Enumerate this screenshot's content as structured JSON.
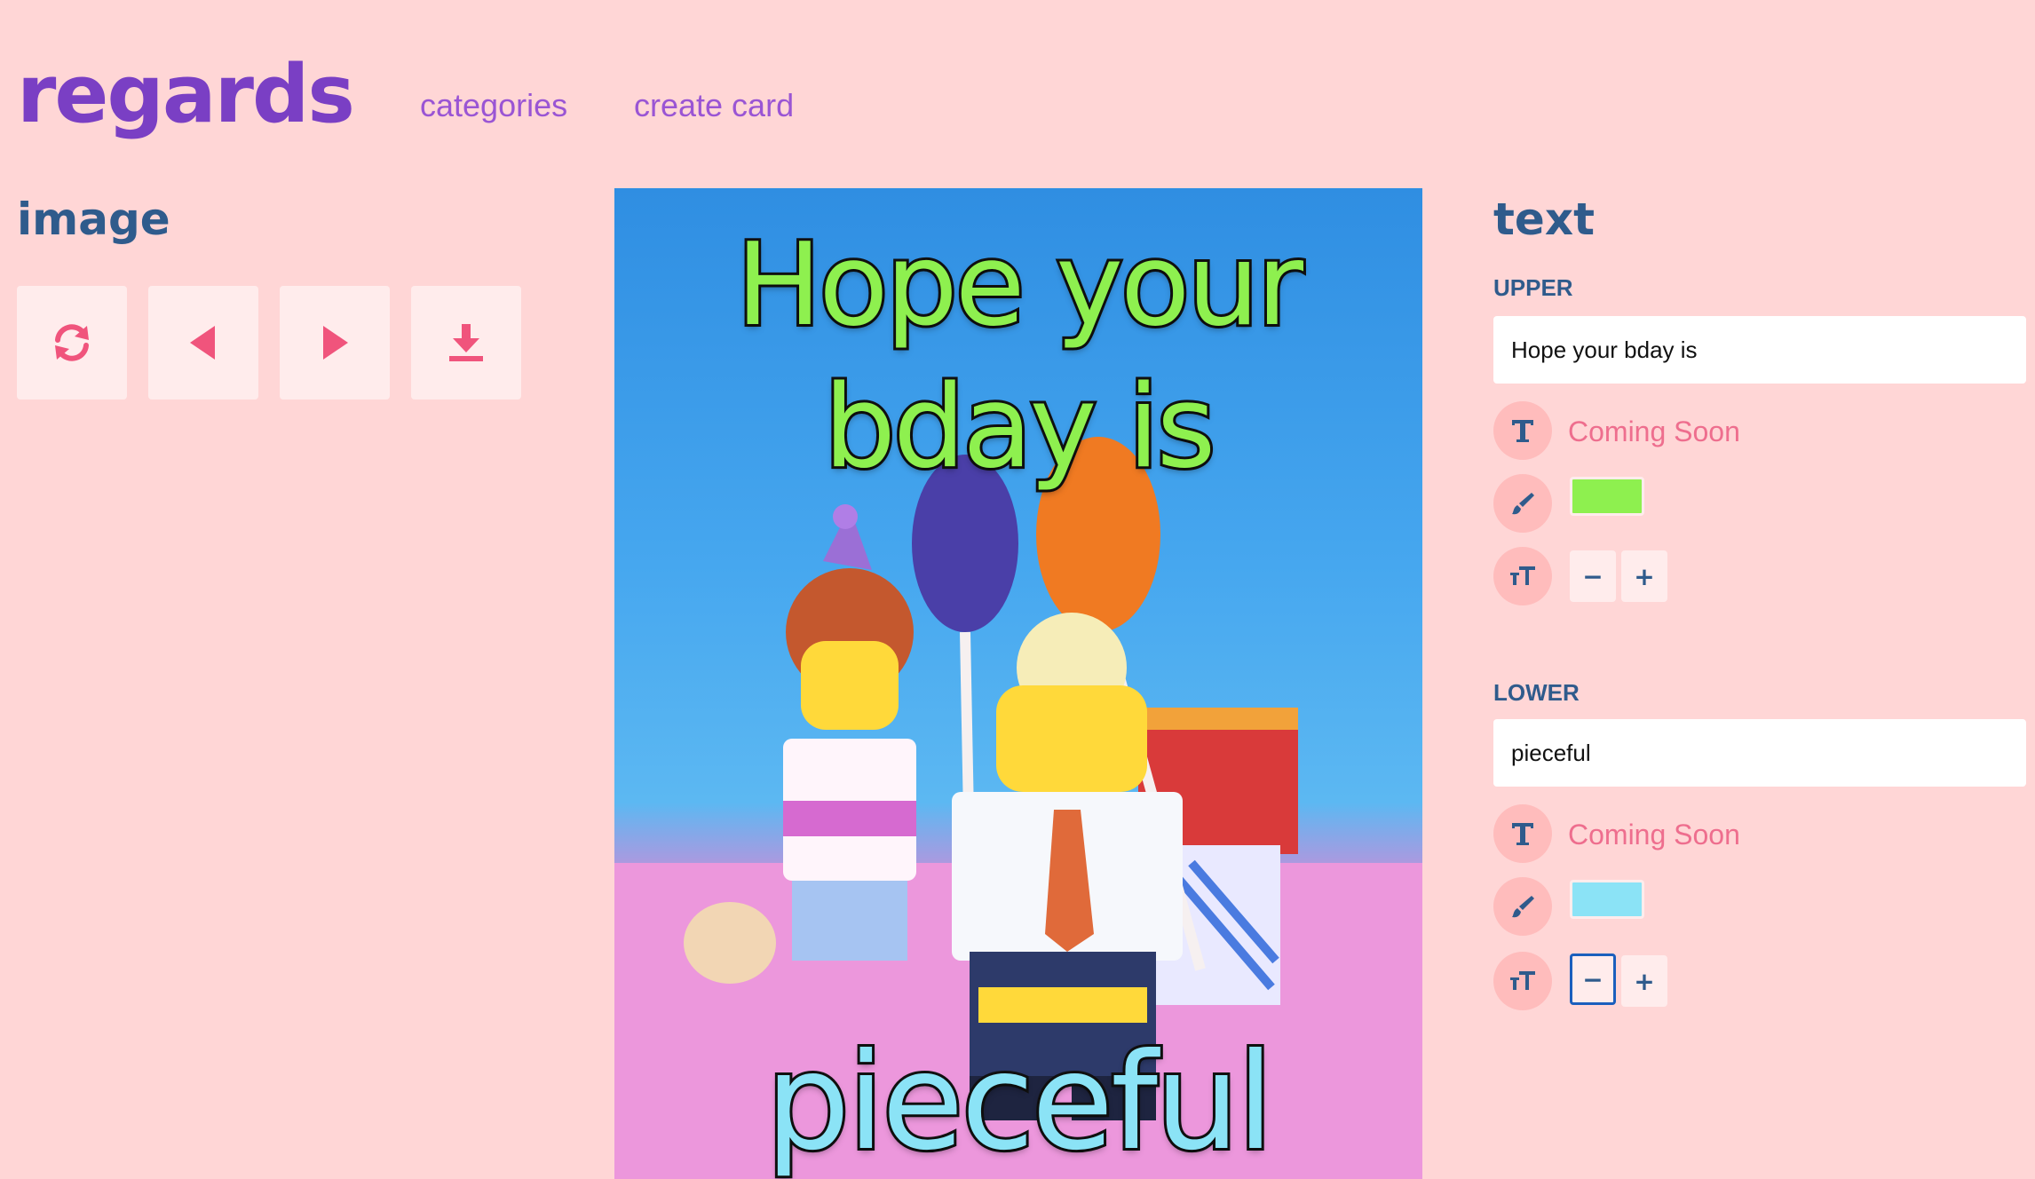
{
  "header": {
    "logo": "regards",
    "nav": {
      "categories": "categories",
      "create_card": "create card"
    }
  },
  "image_panel": {
    "title": "image",
    "buttons": [
      "refresh-icon",
      "prev-icon",
      "next-icon",
      "download-icon"
    ],
    "accent_color": "#f0547c"
  },
  "card": {
    "upper_text": "Hope your bday is",
    "lower_text": "pieceful",
    "upper_color": "#8ef04f",
    "lower_color": "#8be3f6"
  },
  "text_panel": {
    "title": "text",
    "upper": {
      "label": "UPPER",
      "value": "Hope your bday is",
      "font_status": "Coming Soon",
      "color": "#8ef04f",
      "decrease": "−",
      "increase": "+"
    },
    "lower": {
      "label": "LOWER",
      "value": "pieceful",
      "font_status": "Coming Soon",
      "color": "#8be3f6",
      "decrease": "−",
      "increase": "+"
    }
  }
}
